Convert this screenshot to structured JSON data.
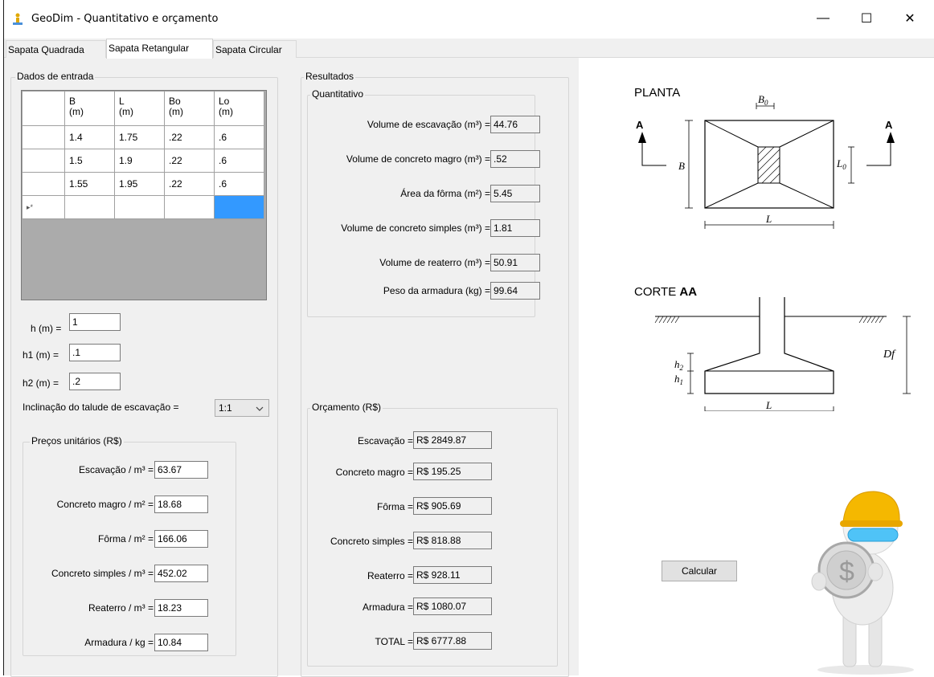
{
  "window": {
    "title": "GeoDim - Quantitativo e orçamento",
    "minimize": "—",
    "maximize": "☐",
    "close": "✕"
  },
  "tabs": [
    "Sapata Quadrada",
    "Sapata Retangular",
    "Sapata Circular"
  ],
  "active_tab": "Sapata Retangular",
  "input_group": {
    "title": "Dados de entrada",
    "grid": {
      "headers": [
        [
          "B",
          "(m)"
        ],
        [
          "L",
          "(m)"
        ],
        [
          "Bo",
          "(m)"
        ],
        [
          "Lo",
          "(m)"
        ]
      ],
      "rows": [
        [
          "1.4",
          "1.75",
          ".22",
          ".6"
        ],
        [
          "1.5",
          "1.9",
          ".22",
          ".6"
        ],
        [
          "1.55",
          "1.95",
          ".22",
          ".6"
        ]
      ],
      "new_row_marker": "▸*"
    },
    "h_label": "h (m) =",
    "h_value": "1",
    "h1_label": "h1 (m) =",
    "h1_value": ".1",
    "h2_label": "h2 (m) =",
    "h2_value": ".2",
    "slope_label": "Inclinação do talude de escavação =",
    "slope_value": "1:1"
  },
  "unit_prices": {
    "title": "Preços unitários (R$)",
    "items": [
      {
        "label": "Escavação / m³ =",
        "value": "63.67"
      },
      {
        "label": "Concreto magro / m² =",
        "value": "18.68"
      },
      {
        "label": "Fôrma / m² =",
        "value": "166.06"
      },
      {
        "label": "Concreto simples / m³ =",
        "value": "452.02"
      },
      {
        "label": "Reaterro / m³ =",
        "value": "18.23"
      },
      {
        "label": "Armadura / kg =",
        "value": "10.84"
      }
    ]
  },
  "results": {
    "title": "Resultados",
    "quant_title": "Quantitativo",
    "quant": [
      {
        "label": "Volume de escavação (m³) =",
        "value": "44.76"
      },
      {
        "label": "Volume de concreto magro (m³) =",
        "value": ".52"
      },
      {
        "label": "Área da fôrma (m²) =",
        "value": "5.45"
      },
      {
        "label": "Volume de concreto simples (m³) =",
        "value": "1.81"
      },
      {
        "label": "Volume de reaterro (m³) =",
        "value": "50.91"
      },
      {
        "label": "Peso da armadura (kg) =",
        "value": "99.64"
      }
    ],
    "budget_title": "Orçamento (R$)",
    "budget": [
      {
        "label": "Escavação =",
        "value": "R$ 2849.87"
      },
      {
        "label": "Concreto magro =",
        "value": "R$ 195.25"
      },
      {
        "label": "Fôrma =",
        "value": "R$ 905.69"
      },
      {
        "label": "Concreto simples =",
        "value": "R$ 818.88"
      },
      {
        "label": "Reaterro =",
        "value": "R$ 928.11"
      },
      {
        "label": "Armadura =",
        "value": "R$ 1080.07"
      },
      {
        "label": "TOTAL =",
        "value": "R$ 6777.88"
      }
    ]
  },
  "diagram": {
    "plan_title": "PLANTA",
    "section_title_a": "CORTE ",
    "section_title_b": "AA",
    "labels": {
      "A": "A",
      "B": "B",
      "L": "L",
      "B0": "B",
      "B0sub": "0",
      "L0": "L",
      "L0sub": "0",
      "h": "h",
      "h2sub": "2",
      "h1sub": "1",
      "Df": "Df"
    }
  },
  "calc_button": "Calcular",
  "colors": {
    "selection": "#3399ff",
    "panel": "#f0f0f0",
    "helmet": "#f5b800",
    "visor": "#4fc3f7"
  }
}
